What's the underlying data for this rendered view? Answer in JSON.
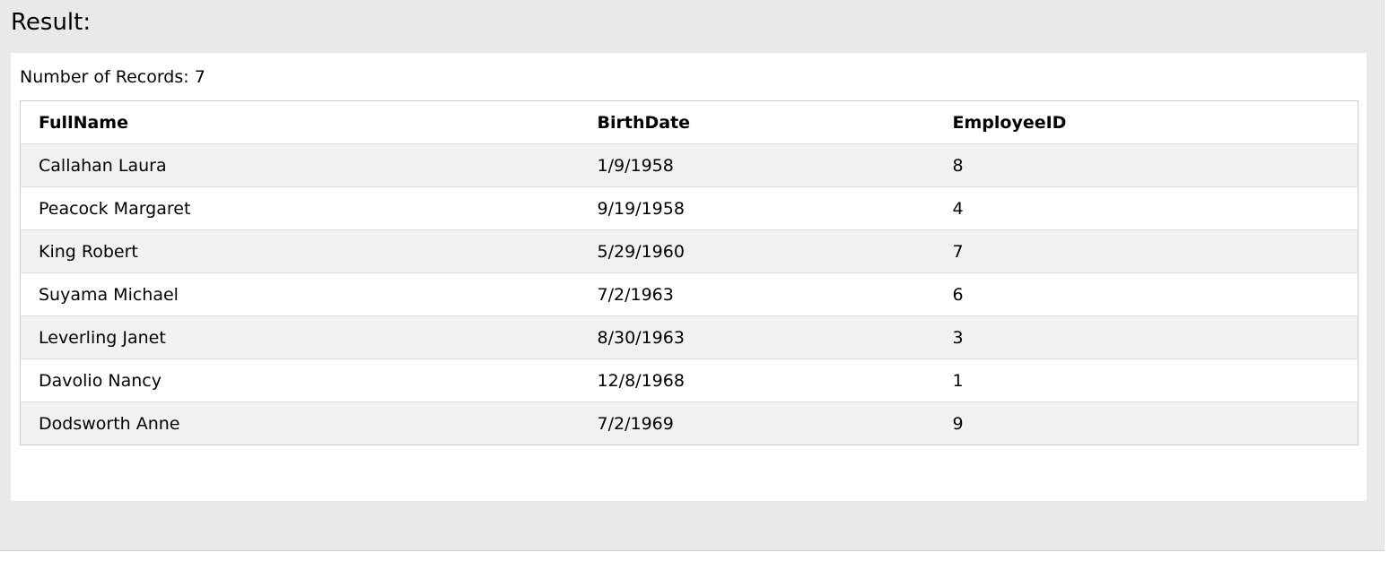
{
  "heading": "Result:",
  "records_label": "Number of Records: 7",
  "table": {
    "columns": [
      "FullName",
      "BirthDate",
      "EmployeeID"
    ],
    "rows": [
      [
        "Callahan Laura",
        "1/9/1958",
        "8"
      ],
      [
        "Peacock Margaret",
        "9/19/1958",
        "4"
      ],
      [
        "King Robert",
        "5/29/1960",
        "7"
      ],
      [
        "Suyama Michael",
        "7/2/1963",
        "6"
      ],
      [
        "Leverling Janet",
        "8/30/1963",
        "3"
      ],
      [
        "Davolio Nancy",
        "12/8/1968",
        "1"
      ],
      [
        "Dodsworth Anne",
        "7/2/1969",
        "9"
      ]
    ]
  },
  "colors": {
    "panel_background": "#e7e9eb",
    "result_background": "#ffffff",
    "row_stripe": "#f1f1f1",
    "table_border": "#cccccc"
  }
}
